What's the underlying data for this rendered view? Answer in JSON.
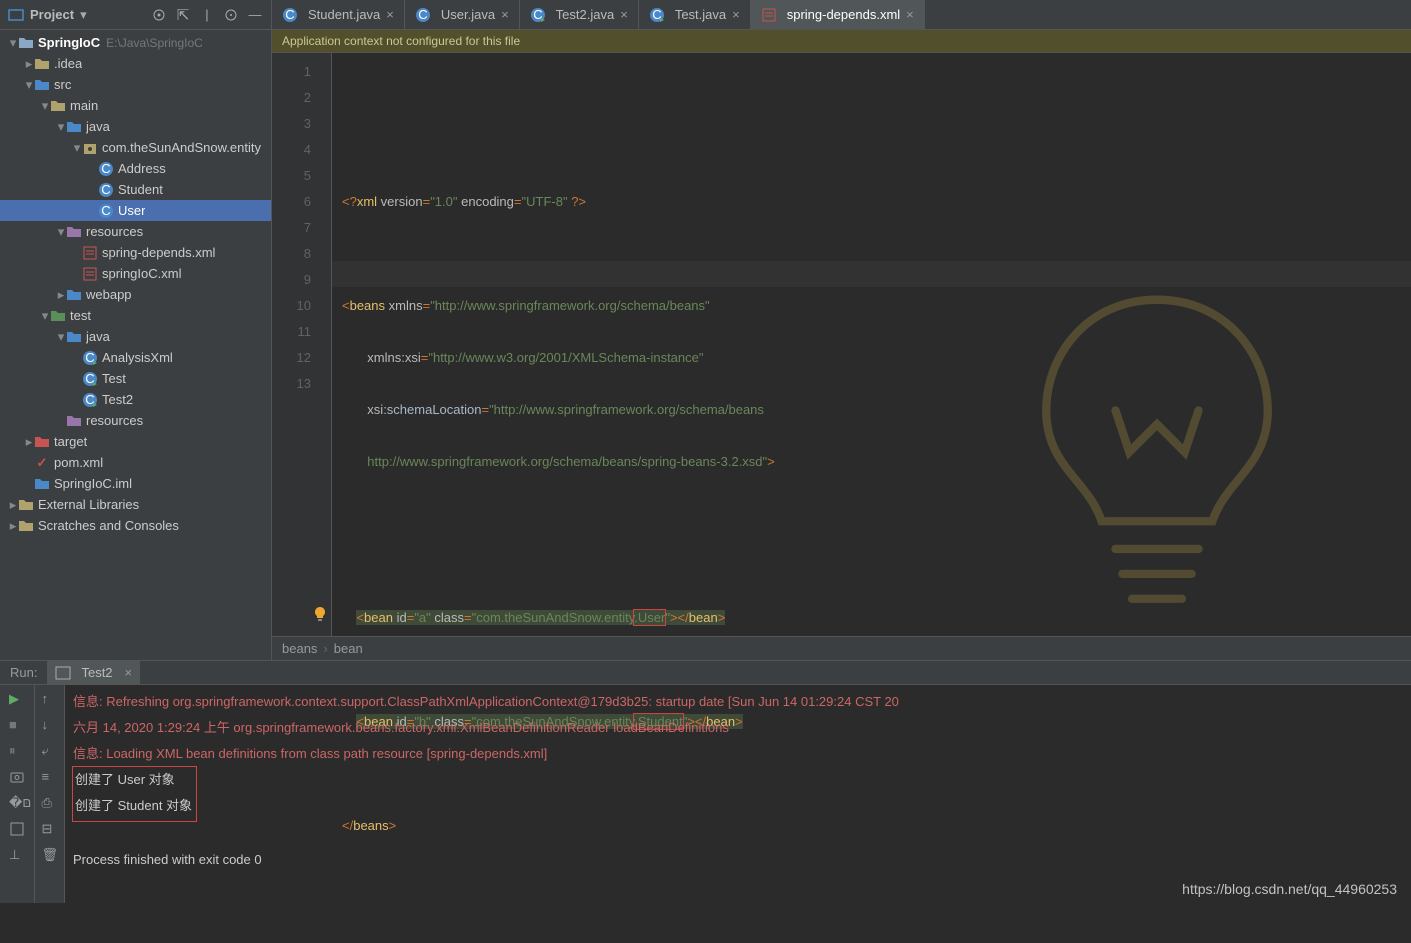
{
  "sidebar": {
    "title": "Project",
    "project_root": "SpringIoC",
    "project_path": "E:\\Java\\SpringIoC",
    "nodes": [
      {
        "indent": 0,
        "arrow": "down",
        "icon": "module",
        "label": "SpringIoC",
        "path": "E:\\Java\\SpringIoC",
        "bold": true
      },
      {
        "indent": 1,
        "arrow": "right",
        "icon": "folder",
        "label": ".idea"
      },
      {
        "indent": 1,
        "arrow": "down",
        "icon": "folder-src",
        "label": "src"
      },
      {
        "indent": 2,
        "arrow": "down",
        "icon": "folder",
        "label": "main"
      },
      {
        "indent": 3,
        "arrow": "down",
        "icon": "folder-src",
        "label": "java"
      },
      {
        "indent": 4,
        "arrow": "down",
        "icon": "package",
        "label": "com.theSunAndSnow.entity"
      },
      {
        "indent": 5,
        "arrow": "",
        "icon": "class",
        "label": "Address"
      },
      {
        "indent": 5,
        "arrow": "",
        "icon": "class",
        "label": "Student"
      },
      {
        "indent": 5,
        "arrow": "",
        "icon": "class",
        "label": "User",
        "selected": true
      },
      {
        "indent": 3,
        "arrow": "down",
        "icon": "folder-res",
        "label": "resources"
      },
      {
        "indent": 4,
        "arrow": "",
        "icon": "xml",
        "label": "spring-depends.xml"
      },
      {
        "indent": 4,
        "arrow": "",
        "icon": "xml",
        "label": "springIoC.xml"
      },
      {
        "indent": 3,
        "arrow": "right",
        "icon": "folder-src",
        "label": "webapp"
      },
      {
        "indent": 2,
        "arrow": "down",
        "icon": "folder-test",
        "label": "test"
      },
      {
        "indent": 3,
        "arrow": "down",
        "icon": "folder-src",
        "label": "java"
      },
      {
        "indent": 4,
        "arrow": "",
        "icon": "class-run",
        "label": "AnalysisXml"
      },
      {
        "indent": 4,
        "arrow": "",
        "icon": "class-run",
        "label": "Test"
      },
      {
        "indent": 4,
        "arrow": "",
        "icon": "class-run",
        "label": "Test2"
      },
      {
        "indent": 3,
        "arrow": "",
        "icon": "folder-res",
        "label": "resources"
      },
      {
        "indent": 1,
        "arrow": "right",
        "icon": "folder-exclude",
        "label": "target"
      },
      {
        "indent": 1,
        "arrow": "",
        "icon": "maven",
        "label": "pom.xml"
      },
      {
        "indent": 1,
        "arrow": "",
        "icon": "iml",
        "label": "SpringIoC.iml"
      },
      {
        "indent": 0,
        "arrow": "right",
        "icon": "lib",
        "label": "External Libraries"
      },
      {
        "indent": 0,
        "arrow": "right",
        "icon": "scratch",
        "label": "Scratches and Consoles"
      }
    ]
  },
  "tabs": [
    {
      "icon": "class",
      "label": "Student.java",
      "active": false
    },
    {
      "icon": "class",
      "label": "User.java",
      "active": false
    },
    {
      "icon": "class-run",
      "label": "Test2.java",
      "active": false
    },
    {
      "icon": "class-run",
      "label": "Test.java",
      "active": false
    },
    {
      "icon": "xml",
      "label": "spring-depends.xml",
      "active": true
    }
  ],
  "banner": "Application context not configured for this file",
  "code": {
    "line_count": 13,
    "intention_line": 9,
    "lines": {
      "l1": "<?xml version=\"1.0\" encoding=\"UTF-8\" ?>",
      "l3_tag": "beans",
      "l3_attr": "xmlns",
      "l3_val": "\"http://www.springframework.org/schema/beans\"",
      "l4_attr": "xmlns:xsi",
      "l4_val": "\"http://www.w3.org/2001/XMLSchema-instance\"",
      "l5_attr": "xsi",
      "l5_attr2": ":schemaLocation",
      "l5_val": "\"http://www.springframework.org/schema/beans",
      "l6_val": "http://www.springframework.org/schema/beans/spring-beans-3.2.xsd\"",
      "l9_id": "\"a\"",
      "l9_class_pre": "\"com.theSunAndSnow.entity",
      "l9_class_hl": ".User",
      "l9_class_end": "\"",
      "l11_id": "\"b\"",
      "l11_class_pre": "\"com.theSunAndSnow.entity",
      "l11_class_hl": ".Student",
      "l11_class_end": "\"",
      "bean": "bean",
      "id_kw": "id",
      "class_kw": "class",
      "beans_close": "beans"
    }
  },
  "breadcrumb": [
    "beans",
    "bean"
  ],
  "run": {
    "label": "Run:",
    "tab": "Test2",
    "lines": [
      {
        "cls": "red",
        "txt": "信息: Refreshing org.springframework.context.support.ClassPathXmlApplicationContext@179d3b25: startup date [Sun Jun 14 01:29:24 CST 20"
      },
      {
        "cls": "red",
        "txt": "六月 14, 2020 1:29:24 上午 org.springframework.beans.factory.xml.XmlBeanDefinitionReader loadBeanDefinitions"
      },
      {
        "cls": "red",
        "txt": "信息: Loading XML bean definitions from class path resource [spring-depends.xml]"
      },
      {
        "cls": "",
        "txt": "创建了 User 对象",
        "boxed": true
      },
      {
        "cls": "",
        "txt": "创建了 Student 对象",
        "boxed": true
      },
      {
        "cls": "",
        "txt": ""
      },
      {
        "cls": "",
        "txt": "Process finished with exit code 0"
      }
    ]
  },
  "watermark": "https://blog.csdn.net/qq_44960253"
}
